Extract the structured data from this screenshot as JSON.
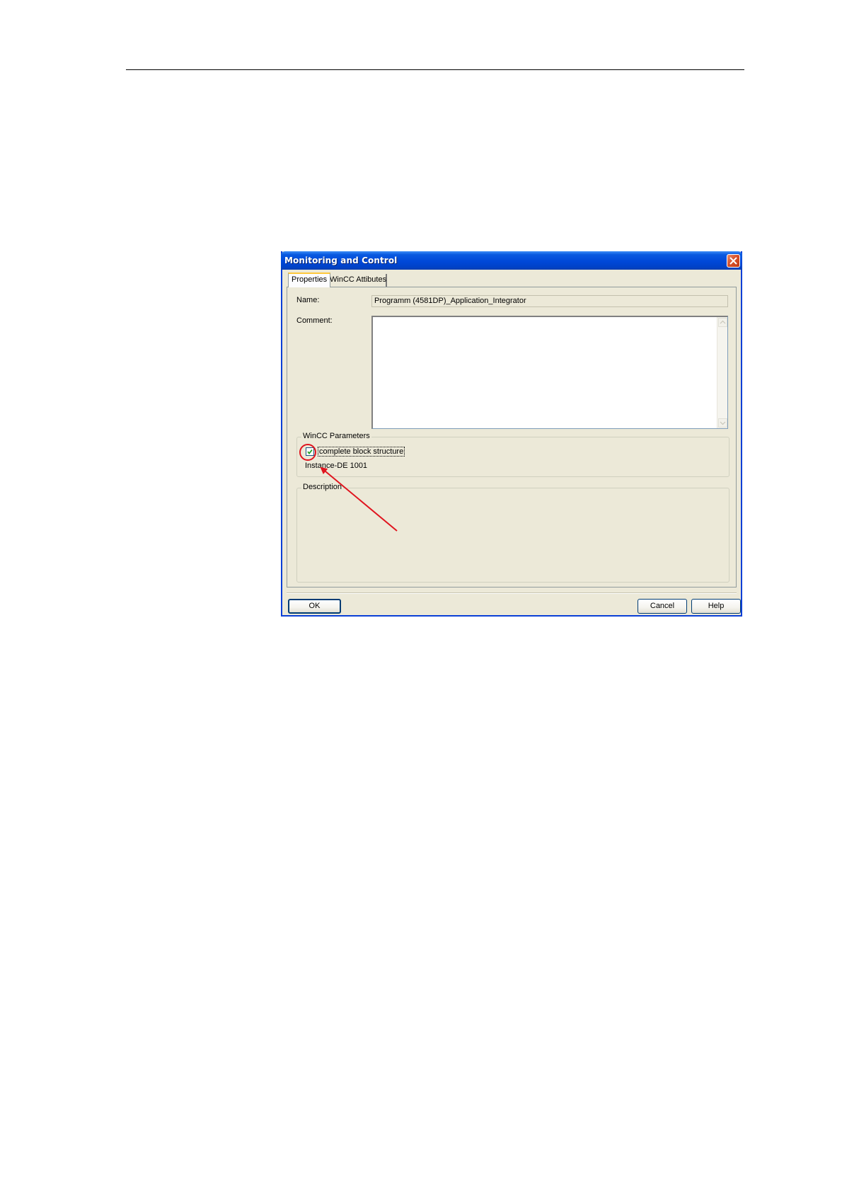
{
  "dialog": {
    "title": "Monitoring and Control",
    "tabs": [
      {
        "label": "Properties",
        "active": true
      },
      {
        "label": "WinCC Attibutes",
        "active": false
      }
    ],
    "name_label": "Name:",
    "name_value": "Programm (4581DP)_Application_Integrator",
    "comment_label": "Comment:",
    "comment_value": "",
    "wincc_group": {
      "legend": "WinCC Parameters",
      "checkbox_label": "complete block structure",
      "checkbox_checked": true,
      "instance_text": "Instance-DE 1001"
    },
    "description_group": {
      "legend": "Description"
    },
    "buttons": {
      "ok": "OK",
      "cancel": "Cancel",
      "help": "Help"
    }
  },
  "colors": {
    "titlebar": "#0048d8",
    "dialog_bg": "#ece9d8",
    "annotation": "#e0141e"
  },
  "icons": [
    "close-icon",
    "checkmark-icon",
    "scroll-up-arrow-icon",
    "scroll-down-arrow-icon"
  ]
}
